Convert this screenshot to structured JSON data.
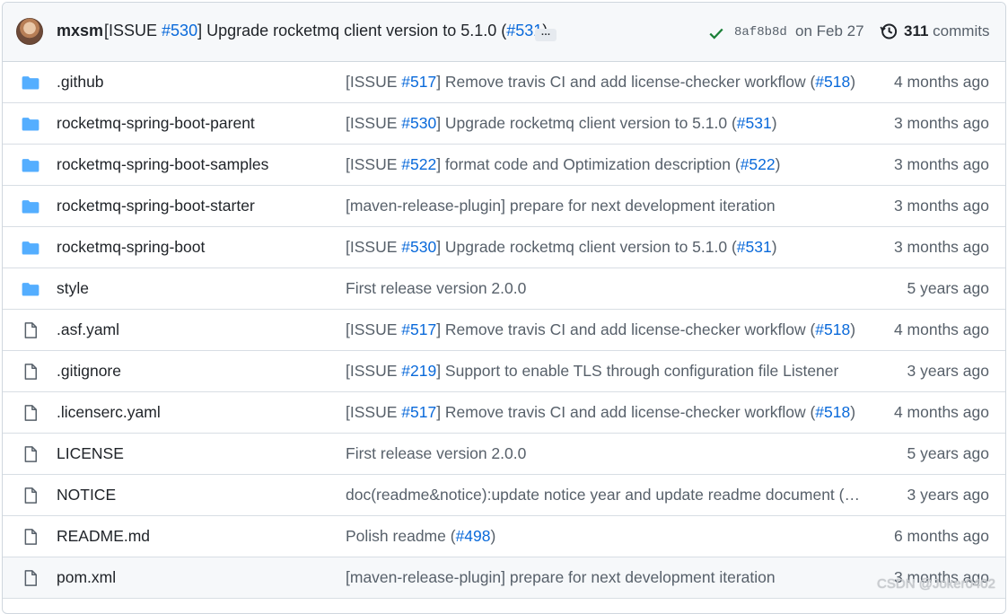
{
  "header": {
    "author": "mxsm",
    "message_pre": "[ISSUE ",
    "issue_link": "#530",
    "message_mid": "] Upgrade rocketmq client version to 5.1.0 (",
    "pr_link": "#531",
    "message_post": ")",
    "ellipsis": "…",
    "sha": "8af8b8d",
    "date": "on Feb 27",
    "commit_count": "311",
    "commit_label": "commits",
    "status_color": "#1a7f37"
  },
  "files": [
    {
      "type": "folder",
      "name": ".github",
      "msg_pre": "[ISSUE ",
      "msg_link1": "#517",
      "msg_mid": "] Remove travis CI and add license-checker workflow (",
      "msg_link2": "#518",
      "msg_post": ")",
      "age": "4 months ago"
    },
    {
      "type": "folder",
      "name": "rocketmq-spring-boot-parent",
      "msg_pre": "[ISSUE ",
      "msg_link1": "#530",
      "msg_mid": "] Upgrade rocketmq client version to 5.1.0 (",
      "msg_link2": "#531",
      "msg_post": ")",
      "age": "3 months ago"
    },
    {
      "type": "folder",
      "name": "rocketmq-spring-boot-samples",
      "msg_pre": "[ISSUE ",
      "msg_link1": "#522",
      "msg_mid": "] format code and Optimization description (",
      "msg_link2": "#522",
      "msg_post": ")",
      "age": "3 months ago"
    },
    {
      "type": "folder",
      "name": "rocketmq-spring-boot-starter",
      "msg_pre": "[maven-release-plugin] prepare for next development iteration",
      "msg_link1": "",
      "msg_mid": "",
      "msg_link2": "",
      "msg_post": "",
      "age": "3 months ago"
    },
    {
      "type": "folder",
      "name": "rocketmq-spring-boot",
      "msg_pre": "[ISSUE ",
      "msg_link1": "#530",
      "msg_mid": "] Upgrade rocketmq client version to 5.1.0 (",
      "msg_link2": "#531",
      "msg_post": ")",
      "age": "3 months ago"
    },
    {
      "type": "folder",
      "name": "style",
      "msg_pre": "First release version 2.0.0",
      "msg_link1": "",
      "msg_mid": "",
      "msg_link2": "",
      "msg_post": "",
      "age": "5 years ago"
    },
    {
      "type": "file",
      "name": ".asf.yaml",
      "msg_pre": "[ISSUE ",
      "msg_link1": "#517",
      "msg_mid": "] Remove travis CI and add license-checker workflow (",
      "msg_link2": "#518",
      "msg_post": ")",
      "age": "4 months ago"
    },
    {
      "type": "file",
      "name": ".gitignore",
      "msg_pre": "[ISSUE ",
      "msg_link1": "#219",
      "msg_mid": "] Support to enable TLS through configuration file Listener",
      "msg_link2": "",
      "msg_post": "",
      "age": "3 years ago"
    },
    {
      "type": "file",
      "name": ".licenserc.yaml",
      "msg_pre": "[ISSUE ",
      "msg_link1": "#517",
      "msg_mid": "] Remove travis CI and add license-checker workflow (",
      "msg_link2": "#518",
      "msg_post": ")",
      "age": "4 months ago"
    },
    {
      "type": "file",
      "name": "LICENSE",
      "msg_pre": "First release version 2.0.0",
      "msg_link1": "",
      "msg_mid": "",
      "msg_link2": "",
      "msg_post": "",
      "age": "5 years ago"
    },
    {
      "type": "file",
      "name": "NOTICE",
      "msg_pre": "doc(readme&notice):update notice year and update readme document (…",
      "msg_link1": "",
      "msg_mid": "",
      "msg_link2": "",
      "msg_post": "",
      "age": "3 years ago"
    },
    {
      "type": "file",
      "name": "README.md",
      "msg_pre": "Polish readme (",
      "msg_link1": "#498",
      "msg_mid": ")",
      "msg_link2": "",
      "msg_post": "",
      "age": "6 months ago"
    },
    {
      "type": "file",
      "name": "pom.xml",
      "msg_pre": "[maven-release-plugin] prepare for next development iteration",
      "msg_link1": "",
      "msg_mid": "",
      "msg_link2": "",
      "msg_post": "",
      "age": "3 months ago"
    }
  ],
  "watermark": "CSDN @Joker0402",
  "colors": {
    "folder": "#54aeff",
    "file": "#57606a",
    "link": "#0969da"
  }
}
